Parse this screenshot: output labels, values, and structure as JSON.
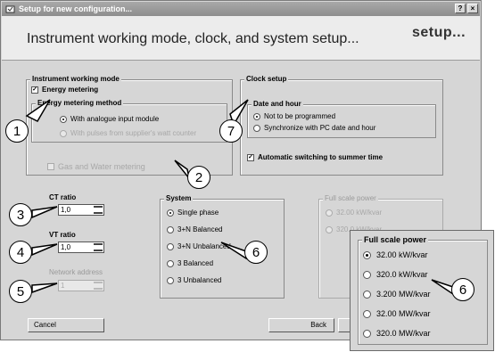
{
  "window": {
    "title": "Setup for new configuration...",
    "help_label": "?",
    "close_label": "×",
    "header_title": "Instrument working mode, clock, and system setup...",
    "header_logo": "setup..."
  },
  "working_mode": {
    "title": "Instrument working mode",
    "energy_metering_label": "Energy metering",
    "method_title": "Energy metering method",
    "method_options": [
      "With analogue input module",
      "With pulses from supplier's watt counter"
    ],
    "gas_water_label": "Gas and Water metering"
  },
  "clock": {
    "title": "Clock setup",
    "date_title": "Date and hour",
    "options": [
      "Not to be programmed",
      "Synchronize with PC date and hour"
    ],
    "summer_label": "Automatic switching to summer time"
  },
  "ct": {
    "label": "CT ratio",
    "value": "1,0"
  },
  "vt": {
    "label": "VT ratio",
    "value": "1,0"
  },
  "network": {
    "label": "Network address",
    "value": "1"
  },
  "system": {
    "title": "System",
    "options": [
      "Single phase",
      "3+N Balanced",
      "3+N Unbalanced",
      "3 Balanced",
      "3 Unbalanced"
    ]
  },
  "fullscale": {
    "title": "Full scale power",
    "options": [
      "32.00 kW/kvar",
      "320.0 kW/kvar"
    ]
  },
  "zoom": {
    "title": "Full scale power",
    "options": [
      "32.00 kW/kvar",
      "320.0 kW/kvar",
      "3.200 MW/kvar",
      "32.00 MW/kvar",
      "320.0 MW/kvar"
    ]
  },
  "buttons": {
    "cancel": "Cancel",
    "back": "Back"
  },
  "callouts": {
    "c1": "1",
    "c2": "2",
    "c3": "3",
    "c4": "4",
    "c5": "5",
    "c6a": "6",
    "c6b": "6",
    "c7": "7"
  }
}
